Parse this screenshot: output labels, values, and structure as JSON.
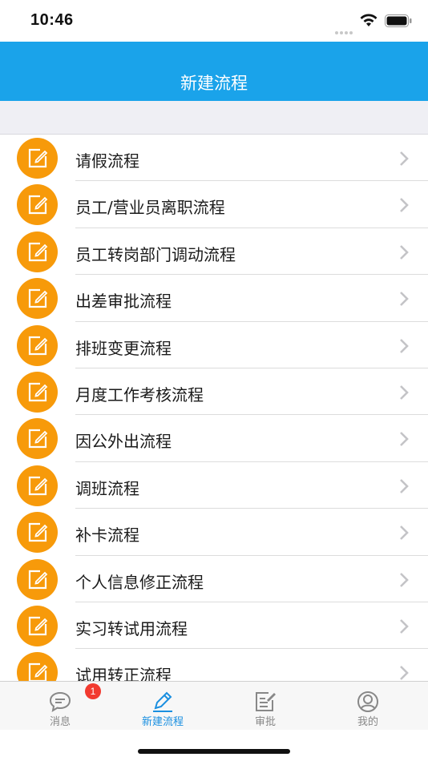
{
  "status_bar": {
    "time": "10:46"
  },
  "header": {
    "title": "新建流程"
  },
  "flows": [
    {
      "label": "请假流程"
    },
    {
      "label": "员工/营业员离职流程"
    },
    {
      "label": "员工转岗部门调动流程"
    },
    {
      "label": "出差审批流程"
    },
    {
      "label": "排班变更流程"
    },
    {
      "label": "月度工作考核流程"
    },
    {
      "label": "因公外出流程"
    },
    {
      "label": "调班流程"
    },
    {
      "label": "补卡流程"
    },
    {
      "label": "个人信息修正流程"
    },
    {
      "label": "实习转试用流程"
    },
    {
      "label": "试用转正流程"
    }
  ],
  "tab_bar": {
    "tabs": [
      {
        "label": "消息",
        "icon": "message-icon",
        "badge": "1"
      },
      {
        "label": "新建流程",
        "icon": "pen-icon",
        "active": true
      },
      {
        "label": "审批",
        "icon": "approve-icon"
      },
      {
        "label": "我的",
        "icon": "profile-icon"
      }
    ]
  },
  "colors": {
    "nav": "#1aa3ea",
    "icon_bg": "#f79a0a",
    "active_tab": "#1a8fe0",
    "badge": "#f23a2f"
  }
}
